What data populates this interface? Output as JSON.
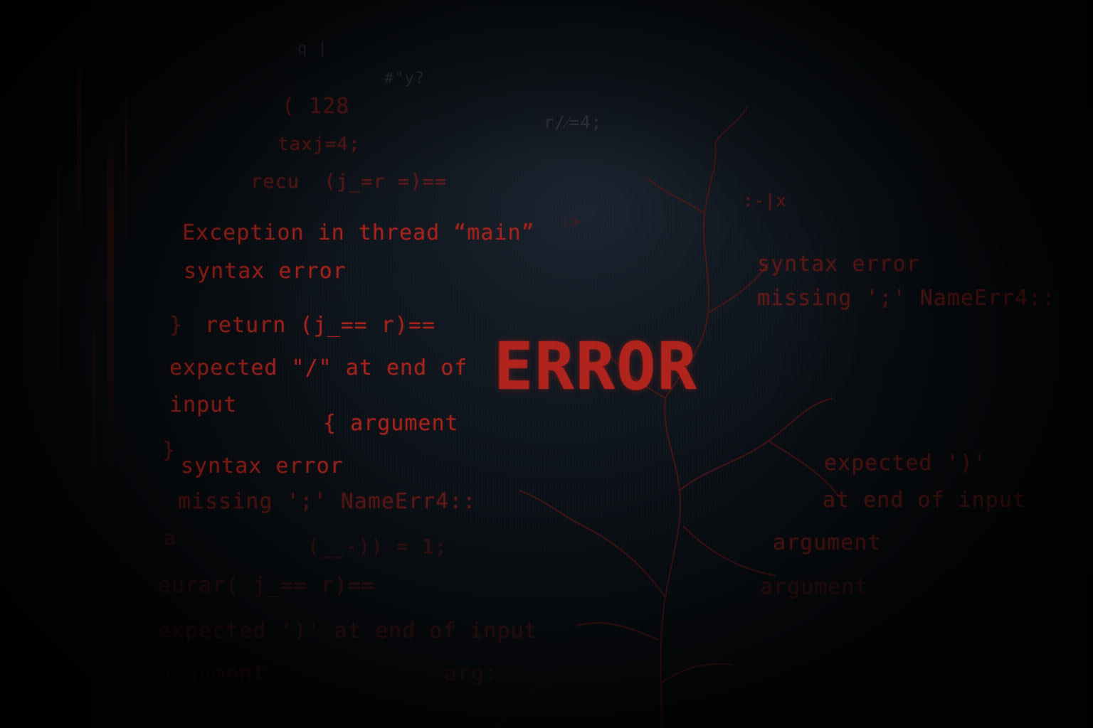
{
  "title": "ERROR",
  "colors": {
    "accent": "#a3221c",
    "background": "#06090d"
  },
  "fragments": {
    "top_q": "q |",
    "hash_y": "#\"y?",
    "num_128": "( 128",
    "taxj": "taxj=4;",
    "recu": "recu  (j_=r =)==",
    "ratio": "r/⁄=4;",
    "colon_x": ":-|x",
    "arrow": ":>",
    "exception": "Exception in thread “main”",
    "syntax_left_1": "syntax error",
    "return_line": "return (j_== r)==",
    "brace_open": "}",
    "expected_line": "expected \"/\" at end of",
    "input_word": "input",
    "argument_mid": "{ argument",
    "brace_close": "}",
    "syntax_left_2": "syntax error",
    "missing_left": "missing ';' NameErr4::",
    "a_line": "a",
    "assign_line": "(__-)) = 1;",
    "eurar_line": "eurar( j_== r)==",
    "expected_paren": "expected ')' at end of input",
    "argument_left": "argument",
    "arg_fragment": "arg:",
    "syntax_right": "syntax error",
    "missing_right": "missing ';' NameErr4::",
    "expected_right": "expected ')'",
    "at_end_right": "at end of input",
    "argument_right_1": "argument",
    "argument_right_2": "argument"
  }
}
